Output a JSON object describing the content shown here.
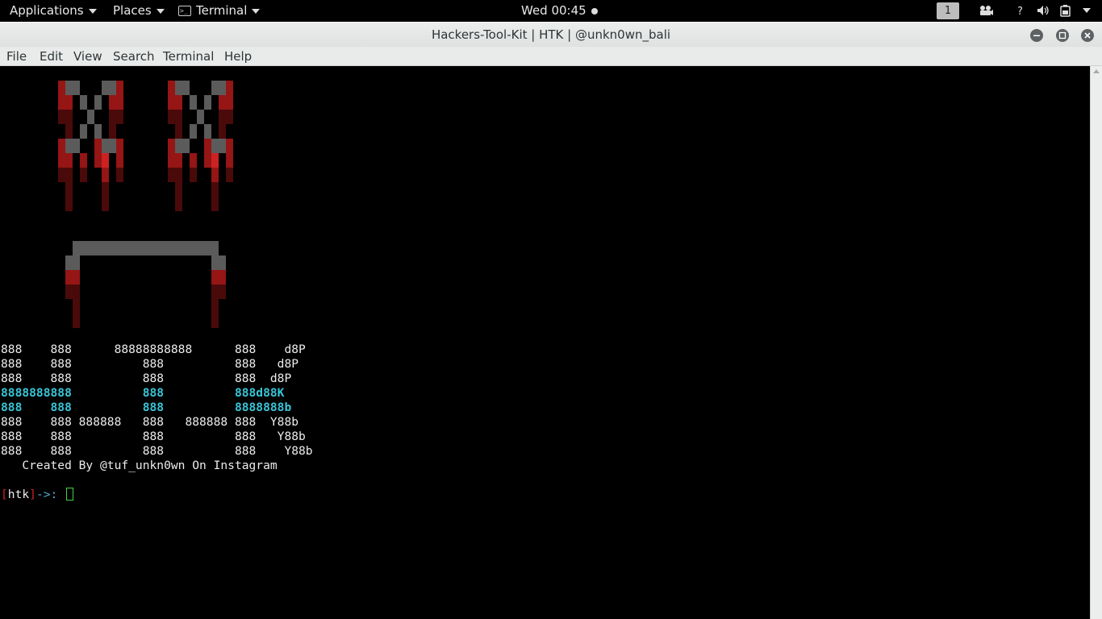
{
  "topbar": {
    "applications": "Applications",
    "places": "Places",
    "terminal_app": "Terminal",
    "clock": "Wed 00:45",
    "workspace": "1"
  },
  "window": {
    "title": "Hackers-Tool-Kit | HTK | @unkn0wn_bali"
  },
  "menubar": [
    "File",
    "Edit",
    "View",
    "Search",
    "Terminal",
    "Help"
  ],
  "banner_lines": [
    "888    888      88888888888      888    d8P",
    "888    888          888          888   d8P",
    "888    888          888          888  d8P",
    "8888888888          888          888d88K",
    "888    888          888          8888888b",
    "888    888 888888   888   888888 888  Y88b",
    "888    888          888          888   Y88b",
    "888    888          888          888    Y88b",
    "   Created By @tuf_unkn0wn On Instagram"
  ],
  "prompt": {
    "open_bracket": "[",
    "name": "htk",
    "close_bracket": "]",
    "arrow": "->: "
  },
  "colors": {
    "accent_cyan": "#38c6d8",
    "prompt_red": "#cc2222",
    "prompt_arrow": "#55a8d0",
    "cursor_green": "#3fd43f",
    "art_gray": "#5b5b5b",
    "art_red": "#961515",
    "art_dark_red": "#4a0a0a"
  }
}
